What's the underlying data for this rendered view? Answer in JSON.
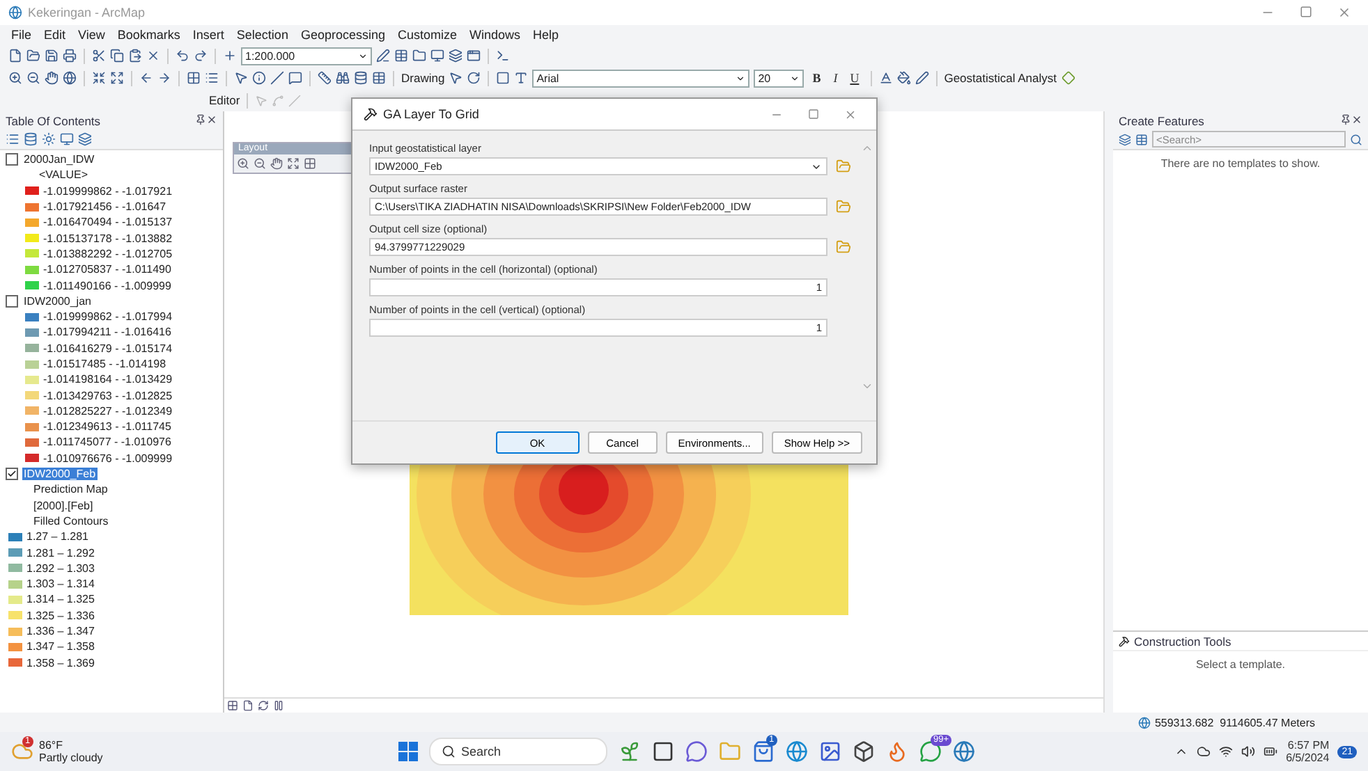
{
  "window": {
    "title": "Kekeringan - ArcMap"
  },
  "menu": [
    "File",
    "Edit",
    "View",
    "Bookmarks",
    "Insert",
    "Selection",
    "Geoprocessing",
    "Customize",
    "Windows",
    "Help"
  ],
  "standard_toolbar": {
    "scale": "1:200.000"
  },
  "drawing_toolbar": {
    "label": "Drawing",
    "font": "Arial",
    "font_size": "20",
    "style_buttons": [
      "B",
      "I",
      "U"
    ]
  },
  "geostatistical_toolbar": {
    "label": "Geostatistical Analyst"
  },
  "editor_toolbar": {
    "label": "Editor"
  },
  "toc": {
    "title": "Table Of Contents",
    "layers": [
      {
        "name": "2000Jan_IDW",
        "checked": false,
        "selected": false,
        "subtitles": [
          "<VALUE>"
        ],
        "classes": [
          {
            "label": "-1.019999862 - -1.017921",
            "color": "#e0201c"
          },
          {
            "label": "-1.017921456 - -1.01647",
            "color": "#ee7430"
          },
          {
            "label": "-1.016470494 - -1.015137",
            "color": "#f4a82c"
          },
          {
            "label": "-1.015137178 - -1.013882",
            "color": "#f2ea1a"
          },
          {
            "label": "-1.013882292 - -1.012705",
            "color": "#c4e83a"
          },
          {
            "label": "-1.012705837 - -1.011490",
            "color": "#7edb40"
          },
          {
            "label": "-1.011490166 - -1.009999",
            "color": "#2fd24a"
          }
        ]
      },
      {
        "name": "IDW2000_jan",
        "checked": false,
        "selected": false,
        "classes": [
          {
            "label": "-1.019999862 - -1.017994",
            "color": "#3a80c0"
          },
          {
            "label": "-1.017994211 - -1.016416",
            "color": "#6e9ab2"
          },
          {
            "label": "-1.016416279 - -1.015174",
            "color": "#96b39c"
          },
          {
            "label": "-1.01517485 - -1.014198",
            "color": "#b9d196"
          },
          {
            "label": "-1.014198164 - -1.013429",
            "color": "#e6e98e"
          },
          {
            "label": "-1.013429763 - -1.012825",
            "color": "#f3d87a"
          },
          {
            "label": "-1.012825227 - -1.012349",
            "color": "#f1b466"
          },
          {
            "label": "-1.012349613 - -1.011745",
            "color": "#e9924c"
          },
          {
            "label": "-1.011745077 - -1.010976",
            "color": "#e06a3c"
          },
          {
            "label": "-1.010976676 - -1.009999",
            "color": "#d42a2a"
          }
        ]
      },
      {
        "name": "IDW2000_Feb",
        "checked": true,
        "selected": true,
        "subtitles": [
          "Prediction Map",
          "[2000].[Feb]",
          "Filled Contours"
        ],
        "classes": [
          {
            "label": "1.27 – 1.281",
            "color": "#2c80b8"
          },
          {
            "label": "1.281 – 1.292",
            "color": "#5c9cb6"
          },
          {
            "label": "1.292 – 1.303",
            "color": "#90baa0"
          },
          {
            "label": "1.303 – 1.314",
            "color": "#b6d28a"
          },
          {
            "label": "1.314 – 1.325",
            "color": "#e4ea8a"
          },
          {
            "label": "1.325 – 1.336",
            "color": "#f7e26b"
          },
          {
            "label": "1.336 – 1.347",
            "color": "#f6bd5a"
          },
          {
            "label": "1.347 – 1.358",
            "color": "#f39240"
          },
          {
            "label": "1.358 – 1.369",
            "color": "#e8673a"
          }
        ]
      }
    ]
  },
  "layout_toolbar": {
    "title": "Layout"
  },
  "dialog": {
    "title": "GA Layer To Grid",
    "fields": [
      {
        "label": "Input geostatistical layer",
        "value": "IDW2000_Feb",
        "kind": "dropdown",
        "browse": true
      },
      {
        "label": "Output surface raster",
        "value": "C:\\Users\\TIKA ZIADHATIN NISA\\Downloads\\SKRIPSI\\New Folder\\Feb2000_IDW",
        "kind": "text",
        "browse": true
      },
      {
        "label": "Output cell size (optional)",
        "value": "94.3799771229029",
        "kind": "text",
        "browse": true
      },
      {
        "label": "Number of points in the cell (horizontal) (optional)",
        "value": "1",
        "kind": "number",
        "browse": false
      },
      {
        "label": "Number of points in the cell (vertical) (optional)",
        "value": "1",
        "kind": "number",
        "browse": false
      }
    ],
    "buttons": [
      {
        "label": "OK",
        "default": true
      },
      {
        "label": "Cancel",
        "default": false
      },
      {
        "label": "Environments...",
        "default": false
      },
      {
        "label": "Show Help >>",
        "default": false
      }
    ]
  },
  "create_features": {
    "title": "Create Features",
    "search_placeholder": "<Search>",
    "message": "There are no templates to show."
  },
  "construction_tools": {
    "title": "Construction Tools",
    "message": "Select a template."
  },
  "status_bar": {
    "coordinates": "559313.682  9114605.47 Meters"
  },
  "taskbar": {
    "temperature": "86°F",
    "condition": "Partly cloudy",
    "weather_badge": "1",
    "search_placeholder": "Search",
    "store_badge": "1",
    "chat_badge": "99+",
    "time": "6:57 PM",
    "date": "6/5/2024",
    "notifications": "21"
  }
}
